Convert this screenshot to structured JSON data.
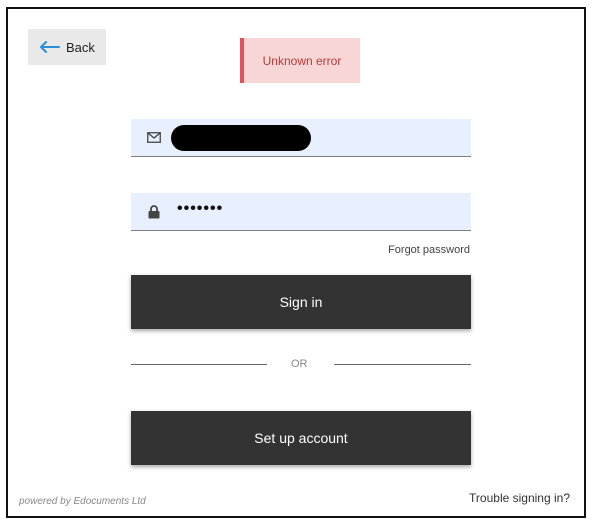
{
  "header": {
    "back_label": "Back",
    "error_message": "Unknown error"
  },
  "form": {
    "email_icon": "envelope-icon",
    "password_icon": "lock-icon",
    "password_value": "•••••••",
    "forgot_label": "Forgot password",
    "signin_label": "Sign in",
    "divider_text": "OR",
    "setup_label": "Set up account"
  },
  "footer": {
    "powered_by": "powered by Edocuments Ltd",
    "trouble_label": "Trouble signing in?"
  },
  "colors": {
    "field_bg": "#e8efff",
    "button_bg": "#333333",
    "error_bg": "#f9d6d6",
    "error_accent": "#e2545d",
    "back_arrow": "#2e8fd8"
  }
}
